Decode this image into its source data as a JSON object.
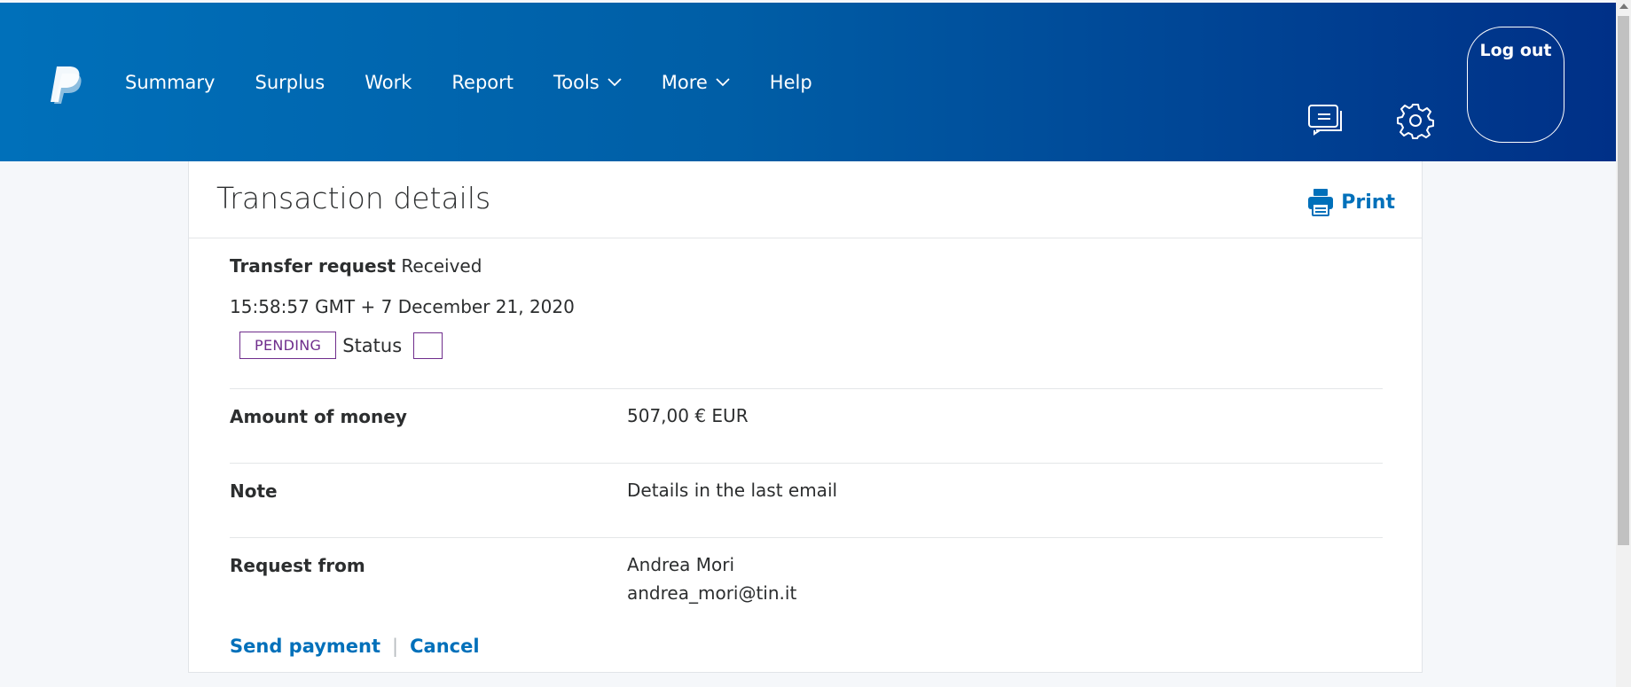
{
  "nav": {
    "items": [
      {
        "label": "Summary",
        "dropdown": false
      },
      {
        "label": "Surplus",
        "dropdown": false
      },
      {
        "label": "Work",
        "dropdown": false
      },
      {
        "label": "Report",
        "dropdown": false
      },
      {
        "label": "Tools",
        "dropdown": true
      },
      {
        "label": "More",
        "dropdown": true
      },
      {
        "label": "Help",
        "dropdown": false
      }
    ],
    "logout_label": "Log out",
    "icons": [
      "paypal-logo-icon",
      "messages-icon",
      "settings-gear-icon"
    ],
    "colors": {
      "gradient_start": "#0070ba",
      "gradient_end": "#003087"
    }
  },
  "card": {
    "title": "Transaction details",
    "print_label": "Print"
  },
  "summary": {
    "type": "Transfer request",
    "state": "Received",
    "timestamp": "15:58:57 GMT + 7 December 21, 2020",
    "badge": "PENDING",
    "status_label": "Status"
  },
  "details": {
    "amount": {
      "label": "Amount of money",
      "value": "507,00 € EUR"
    },
    "note": {
      "label": "Note",
      "value": "Details in the last email"
    },
    "request_from": {
      "label": "Request from",
      "name": "Andrea Mori",
      "email": "andrea_mori@tin.it"
    }
  },
  "actions": {
    "send_payment": "Send payment",
    "separator": "|",
    "cancel": "Cancel"
  },
  "accent_colors": {
    "link": "#0070ba",
    "pending": "#6f2d8c"
  }
}
